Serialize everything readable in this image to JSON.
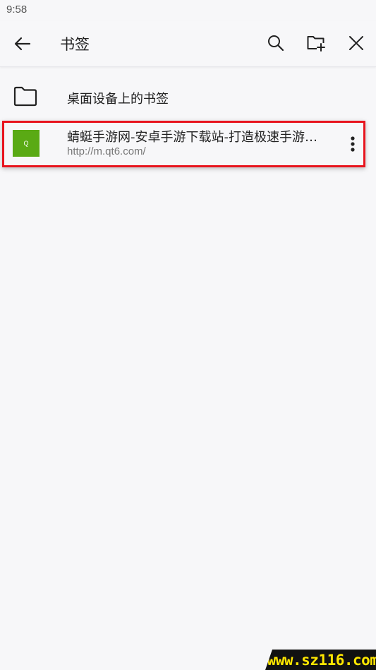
{
  "status_bar": {
    "time": "9:58"
  },
  "app_bar": {
    "title": "书签",
    "icons": {
      "back": "arrow-left-icon",
      "search": "search-icon",
      "new_folder": "folder-plus-icon",
      "close": "close-icon"
    }
  },
  "folders": [
    {
      "label": "桌面设备上的书签",
      "icon": "folder-icon"
    }
  ],
  "bookmarks": [
    {
      "title": "蜻蜓手游网-安卓手游下载站-打造极速手游…",
      "url": "http://m.qt6.com/",
      "favicon_letter": "Q",
      "favicon_color": "#5aaa14",
      "menu_icon": "more-vert-icon"
    }
  ],
  "highlight_color": "#e8141e",
  "watermark": {
    "text": "www.sz116.com",
    "text_color": "#ffe600",
    "background": "#111111"
  }
}
